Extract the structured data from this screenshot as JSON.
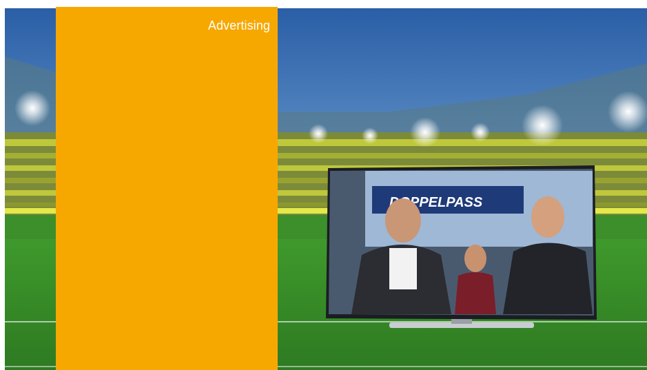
{
  "ad": {
    "label": "Advertising",
    "color": "#f6a800"
  },
  "tv": {
    "show_title": "DOPPELPASS"
  },
  "colors": {
    "sky_top": "#2b5fa8",
    "grass": "#3a8a2a",
    "seats": "#d3d93a"
  }
}
